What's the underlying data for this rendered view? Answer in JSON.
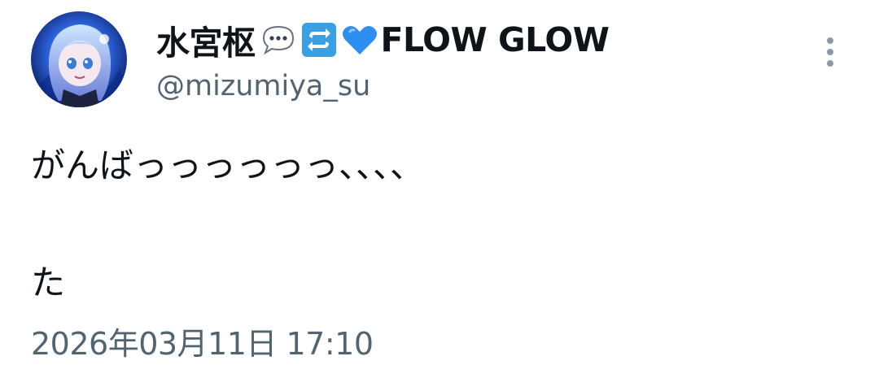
{
  "tweet": {
    "author": {
      "display_name": "水宮枢",
      "emojis": [
        "speech-balloon-icon",
        "repeat-arrows-icon",
        "blue-heart-icon"
      ],
      "display_name_suffix": "FLOW GLOW",
      "handle": "@mizumiya_su",
      "avatar": "avatar-image"
    },
    "text": "がんばっっっっっっ、、、、\n\nた",
    "timestamp": "2026年03月11日 17:10"
  },
  "colors": {
    "primary_text": "#0f1419",
    "secondary_text": "#536471",
    "icon_gray": "#8b98a5",
    "heart_blue": "#2b8ef0",
    "repeat_blue": "#3aa0e6"
  }
}
